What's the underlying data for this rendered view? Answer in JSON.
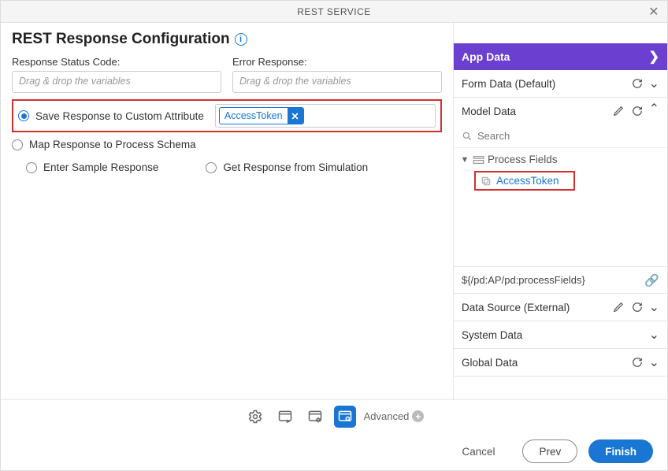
{
  "titlebar": {
    "title": "REST SERVICE"
  },
  "header": {
    "title": "REST Response Configuration"
  },
  "fields": {
    "status_label": "Response Status Code:",
    "status_placeholder": "Drag & drop the variables",
    "error_label": "Error Response:",
    "error_placeholder": "Drag & drop the variables"
  },
  "options": {
    "save_custom": "Save Response to Custom Attribute",
    "map_schema": "Map Response to Process Schema",
    "enter_sample": "Enter Sample Response",
    "get_sim": "Get Response from Simulation"
  },
  "chip": {
    "label": "AccessToken"
  },
  "appdata": {
    "header": "App Data",
    "sections": {
      "form": "Form Data (Default)",
      "model": "Model Data",
      "datasource": "Data Source (External)",
      "system": "System Data",
      "global": "Global Data"
    },
    "search_placeholder": "Search",
    "tree": {
      "root": "Process Fields",
      "child": "AccessToken"
    },
    "expression": "${/pd:AP/pd:processFields}"
  },
  "bottombar": {
    "advanced": "Advanced"
  },
  "footer": {
    "cancel": "Cancel",
    "prev": "Prev",
    "finish": "Finish"
  }
}
